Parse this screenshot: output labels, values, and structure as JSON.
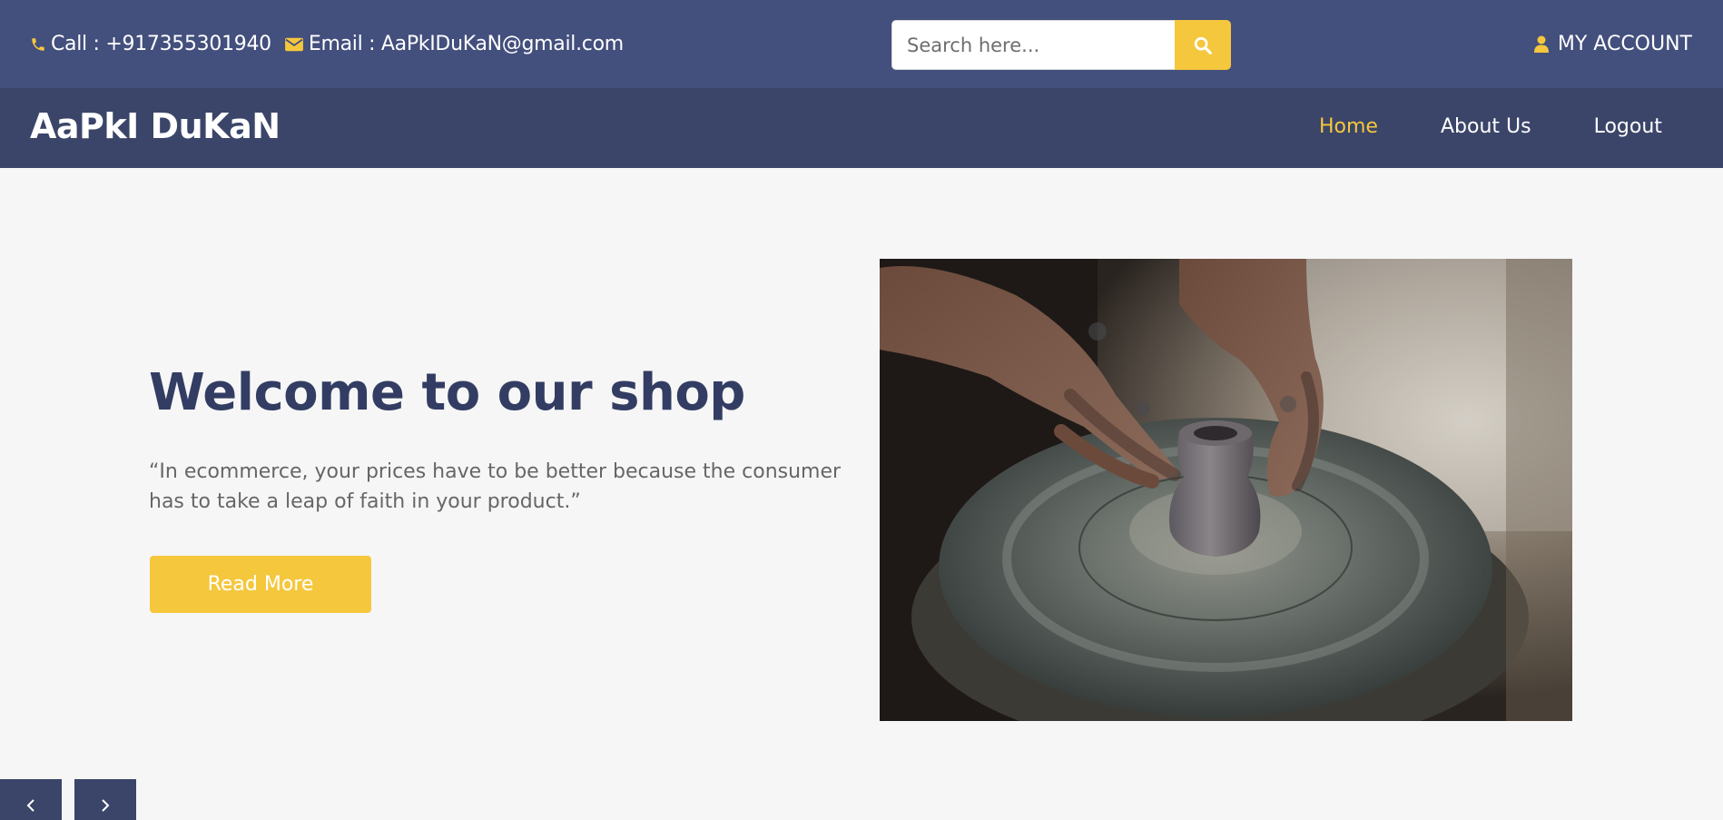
{
  "topbar": {
    "phone_text": "Call : +917355301940",
    "email_text": "Email : AaPkIDuKaN@gmail.com",
    "search_placeholder": "Search here...",
    "account_label": "MY ACCOUNT"
  },
  "nav": {
    "brand": "AaPkI DuKaN",
    "links": [
      {
        "label": "Home",
        "active": true
      },
      {
        "label": "About Us",
        "active": false
      },
      {
        "label": "Logout",
        "active": false
      }
    ]
  },
  "hero": {
    "title": "Welcome to our shop",
    "quote": "“In ecommerce, your prices have to be better because the consumer has to take a leap of faith in your product.”",
    "button_label": "Read More"
  },
  "carousel": {
    "prev_icon": "chevron-left-icon",
    "next_icon": "chevron-right-icon"
  },
  "icons": {
    "phone": "phone-icon",
    "email": "envelope-icon",
    "search": "search-icon",
    "account": "user-icon"
  },
  "colors": {
    "topbar_bg": "#434f7c",
    "navbar_bg": "#3b4569",
    "accent": "#f5c73d",
    "title": "#333d63",
    "page_bg": "#f6f6f6"
  }
}
